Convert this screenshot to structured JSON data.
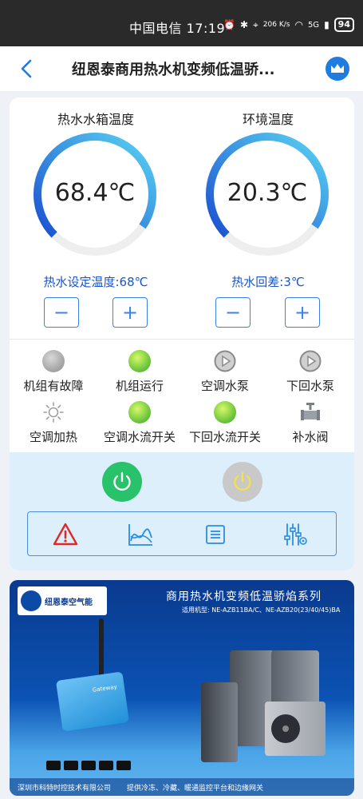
{
  "status_bar": {
    "carrier_time": "中国电信 17:19",
    "net_speed": "206 K/s",
    "signal": "5G",
    "battery": "94"
  },
  "header": {
    "title": "纽恩泰商用热水机变频低温骄...",
    "back_icon": "chevron-left-icon",
    "crown_icon": "crown-icon"
  },
  "gauges": [
    {
      "title": "热水水箱温度",
      "value": "68.4℃",
      "level": 0.72,
      "setting": "热水设定温度:68℃"
    },
    {
      "title": "环境温度",
      "value": "20.3℃",
      "level": 0.72,
      "setting": "热水回差:3℃"
    }
  ],
  "stepper": {
    "minus": "−",
    "plus": "+"
  },
  "status_items": [
    {
      "label": "机组有故障",
      "icon": "grey-indicator"
    },
    {
      "label": "机组运行",
      "icon": "green-indicator"
    },
    {
      "label": "空调水泵",
      "icon": "pump-icon"
    },
    {
      "label": "下回水泵",
      "icon": "pump-icon"
    },
    {
      "label": "空调加热",
      "icon": "sun-icon"
    },
    {
      "label": "空调水流开关",
      "icon": "green-indicator"
    },
    {
      "label": "下回水流开关",
      "icon": "green-indicator"
    },
    {
      "label": "补水阀",
      "icon": "valve-icon"
    }
  ],
  "controls": {
    "power_on_color": "#27c26a",
    "power_off_color": "#c9c9c9",
    "tools": [
      "warning-icon",
      "trend-chart-icon",
      "list-icon",
      "settings-sliders-icon"
    ]
  },
  "banner": {
    "logo_text": "纽恩泰空气能",
    "title": "商用热水机变频低温骄焰系列",
    "subtitle": "适用机型: NE-AZB11BA/C、NE-AZB20(23/40/45)BA",
    "footer_left": "深圳市科特时控技术有限公司",
    "footer_right": "提供冷冻、冷藏、暖通监控平台和边缘网关",
    "gateway_label": "Gateway"
  },
  "colors": {
    "accent": "#1e7ce0",
    "text_blue": "#1a55cc"
  }
}
